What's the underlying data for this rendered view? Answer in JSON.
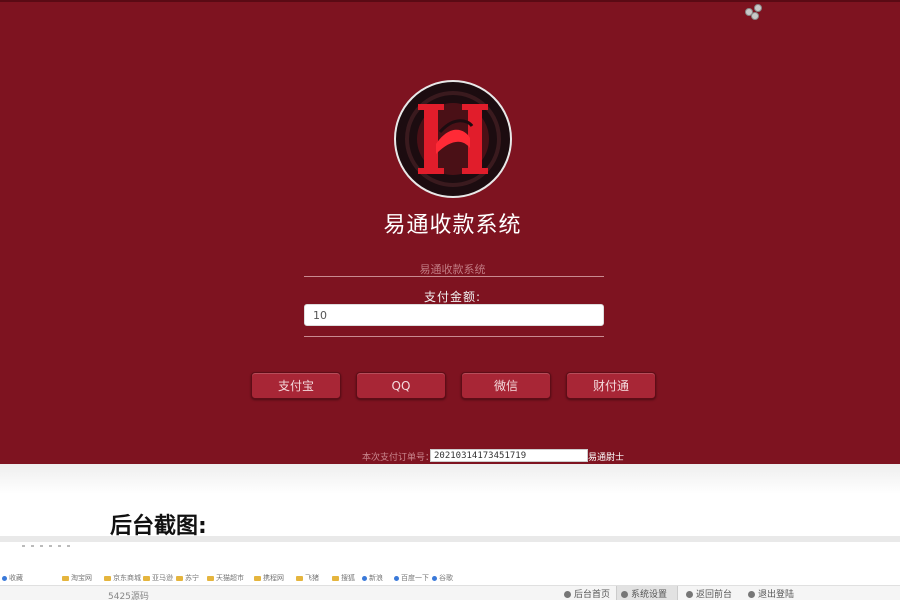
{
  "payment": {
    "title": "易通收款系统",
    "subtitle": "易通收款系统",
    "amount_label": "支付金额:",
    "amount_value": "10",
    "buttons": [
      "支付宝",
      "QQ",
      "微信",
      "财付通"
    ],
    "order_label": "本次支付订单号：",
    "order_number": "20210314173451719",
    "brand": "易通尉士",
    "logo_letter": "H"
  },
  "article": {
    "heading": "后台截图:"
  },
  "bookmarks": [
    "收藏",
    "淘宝网",
    "京东商城",
    "亚马逊",
    "苏宁",
    "天猫超市",
    "携程网",
    "飞猪",
    "搜狐",
    "新浪",
    "百度一下",
    "谷歌"
  ],
  "admin": {
    "logo": "5425源码",
    "tabs": [
      "后台首页",
      "系统设置",
      "返回前台",
      "退出登陆"
    ]
  },
  "colors": {
    "panel_bg": "#7e1320",
    "button_bg": "#a82636",
    "logo_red": "#e11d2b"
  },
  "icons": {
    "logo": "h-emblem-icon",
    "tab_icons": [
      "home-icon",
      "gear-icon",
      "arrow-up-icon",
      "refresh-icon"
    ]
  }
}
